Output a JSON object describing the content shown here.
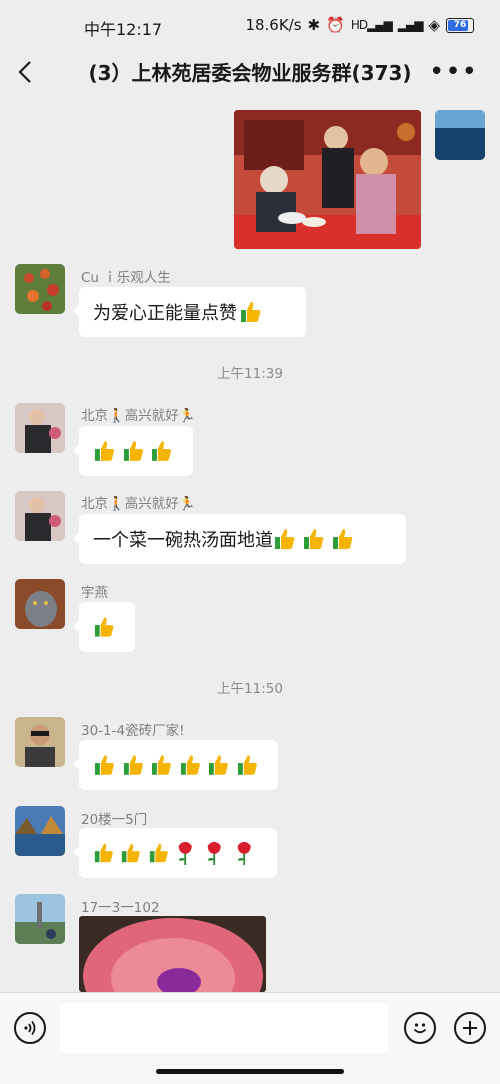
{
  "status_bar": {
    "time": "中午12:17",
    "net_speed": "18.6K/s",
    "battery": "76",
    "signal_label": "HD"
  },
  "header": {
    "title": "(3）上林苑居委会物业服务群(373)"
  },
  "messages": {
    "m1": {
      "sender": "Cu ｉ乐观人生",
      "text": "为爱心正能量点赞"
    },
    "ts1": "上午11:39",
    "m2": {
      "sender": "北京🚶高兴就好🏃"
    },
    "m3": {
      "sender": "北京🚶高兴就好🏃",
      "text": "一个菜一碗热汤面地道"
    },
    "m4": {
      "sender": "宇燕"
    },
    "ts2": "上午11:50",
    "m5": {
      "sender": "30-1-4瓷砖厂家!"
    },
    "m6": {
      "sender": "20楼一5门"
    },
    "m7": {
      "sender": "17一3一102"
    }
  },
  "colors": {
    "background": "#ededed",
    "bubble": "#ffffff",
    "accent_thumb": "#f4b400",
    "rose": "#d81e2c"
  },
  "icons": [
    "back-icon",
    "more-icon",
    "voice-icon",
    "emoji-icon",
    "plus-icon",
    "thumbs-up-icon",
    "rose-icon"
  ]
}
